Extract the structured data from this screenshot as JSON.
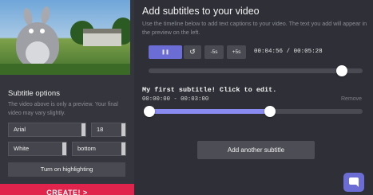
{
  "options": {
    "title": "Subtitle options",
    "description": "The video above is only a preview. Your final video may vary slightly.",
    "font": "Arial",
    "size": "18",
    "color": "White",
    "position": "bottom",
    "highlight_label": "Turn on highlighting",
    "create_label": "CREATE! >"
  },
  "header": {
    "title": "Add subtitles to your video",
    "description": "Use the timeline below to add text captions to your video. The text you add will appear in the preview on the left."
  },
  "controls": {
    "back5": "-5s",
    "fwd5": "+5s",
    "current_time": "00:04:56",
    "separator": "/",
    "total_time": "00:05:28",
    "play_glyph": "❚❚",
    "replay_glyph": "↺",
    "position_fraction": 0.904
  },
  "subtitle": {
    "text": "My first subtitle! Click to edit.",
    "range": "00:00:00 - 00:03:00",
    "remove_label": "Remove"
  },
  "add_label": "Add another subtitle",
  "colors": {
    "accent": "#6b6cd4",
    "create": "#e0244b",
    "range": "#8a8bf0"
  },
  "icons": [
    "pause-icon",
    "replay-icon",
    "chat-icon",
    "chevron-right-icon"
  ]
}
